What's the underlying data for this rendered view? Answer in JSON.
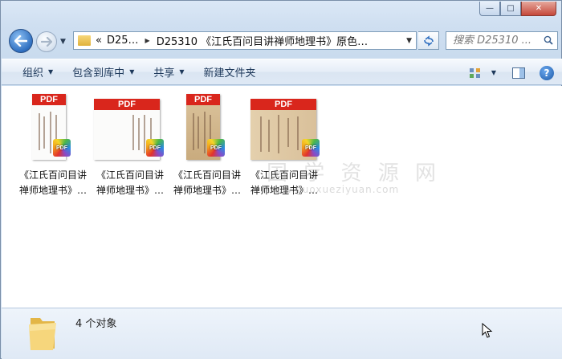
{
  "window": {
    "minimize_glyph": "—",
    "maximize_glyph": "□",
    "close_glyph": "✕"
  },
  "address_bar": {
    "segments": [
      "«",
      "D25…",
      "D25310 《江氏百问目讲禅师地理书》原色…"
    ],
    "refresh_icon": "refresh-icon"
  },
  "search": {
    "placeholder": "搜索 D25310 ..."
  },
  "toolbar": {
    "organize": "组织",
    "include_in_library": "包含到库中",
    "share": "共享",
    "new_folder": "新建文件夹"
  },
  "files": [
    {
      "name_line1": "《江氏百问目讲",
      "name_line2": "禅师地理书》…",
      "style": "white"
    },
    {
      "name_line1": "《江氏百问目讲",
      "name_line2": "禅师地理书》…",
      "style": "white-landscape"
    },
    {
      "name_line1": "《江氏百问目讲",
      "name_line2": "禅师地理书》…",
      "style": "tan"
    },
    {
      "name_line1": "《江氏百问目讲",
      "name_line2": "禅师地理书》…",
      "style": "tan-landscape"
    }
  ],
  "thumbnail": {
    "pdf_label": "PDF",
    "badge_label": "PDF"
  },
  "watermark": {
    "text": "国 学 资 源 网",
    "url": "www.guoxueziyuan.com"
  },
  "details": {
    "item_count": "4 个对象"
  },
  "colors": {
    "pdf_red": "#d9261c",
    "toolbar_text": "#1e395b",
    "aged_paper": "#d9c09a"
  }
}
